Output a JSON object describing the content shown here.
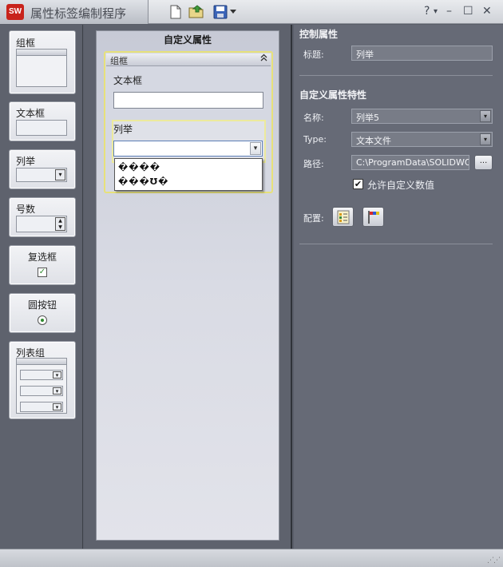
{
  "titlebar": {
    "app_icon_text": "SW",
    "title": "属性标签编制程序",
    "toolbar_icons": [
      "new-document-icon",
      "open-folder-icon",
      "save-icon",
      "dropdown-arrow-icon"
    ],
    "help_label": "?",
    "help_arrow": "▾",
    "minimize_label": "–",
    "maximize_label": "☐",
    "close_label": "✕"
  },
  "toolbox": {
    "groupbox_label": "组框",
    "textbox_label": "文本框",
    "list_label": "列举",
    "number_label": "号数",
    "checkbox_label": "复选框",
    "radio_label": "圆按钮",
    "listgroup_label": "列表组"
  },
  "canvas": {
    "title": "自定义属性",
    "group_label": "组框",
    "textbox_label": "文本框",
    "list_label": "列举",
    "dropdown_items": [
      "����",
      "���Ʊ�"
    ]
  },
  "panel": {
    "control_section": "控制属性",
    "caption_label": "标题:",
    "caption_value": "列举",
    "custom_section": "自定义属性特性",
    "name_label": "名称:",
    "name_value": "列举5",
    "type_label": "Type:",
    "type_value": "文本文件",
    "path_label": "路径:",
    "path_value": "C:\\ProgramData\\SOLIDWORKS",
    "browse_label": "...",
    "allow_custom_label": "允许自定义数值",
    "allow_custom_checked": true,
    "config_label": "配置:"
  },
  "colors": {
    "panel_bg": "#666a76",
    "highlight_yellow": "#e7e17a",
    "logo_red": "#c8231b"
  }
}
